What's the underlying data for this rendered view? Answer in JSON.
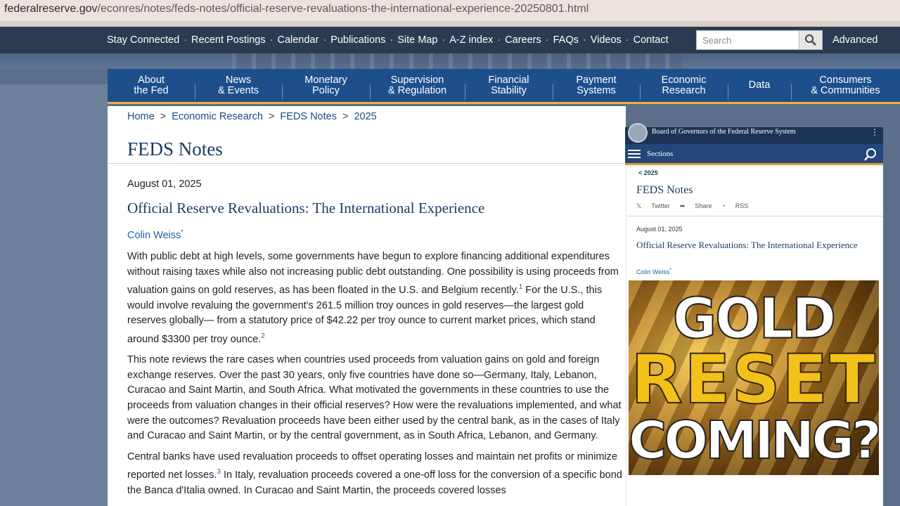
{
  "browser": {
    "url_domain": "federalreserve.gov",
    "url_path": "/econres/notes/feds-notes/official-reserve-revaluations-the-international-experience-20250801.html"
  },
  "topbar": {
    "links": [
      "Stay Connected",
      "Recent Postings",
      "Calendar",
      "Publications",
      "Site Map",
      "A-Z index",
      "Careers",
      "FAQs",
      "Videos",
      "Contact"
    ],
    "search_placeholder": "Search",
    "advanced_label": "Advanced"
  },
  "mainnav": {
    "items": [
      {
        "l1": "About",
        "l2": "the Fed"
      },
      {
        "l1": "News",
        "l2": "& Events"
      },
      {
        "l1": "Monetary",
        "l2": "Policy"
      },
      {
        "l1": "Supervision",
        "l2": "& Regulation"
      },
      {
        "l1": "Financial",
        "l2": "Stability"
      },
      {
        "l1": "Payment",
        "l2": "Systems"
      },
      {
        "l1": "Economic",
        "l2": "Research"
      },
      {
        "l1": "Data",
        "l2": ""
      },
      {
        "l1": "Consumers",
        "l2": "& Communities"
      }
    ]
  },
  "breadcrumb": [
    "Home",
    "Economic Research",
    "FEDS Notes",
    "2025"
  ],
  "section_title": "FEDS Notes",
  "article": {
    "date": "August 01, 2025",
    "title": "Official Reserve Revaluations: The International Experience",
    "author": "Colin Weiss",
    "author_mark": "*",
    "p1_a": "With public debt at high levels, some governments have begun to explore financing additional expenditures without raising taxes while also not increasing public debt outstanding. One possibility is using proceeds from valuation gains on gold reserves, as has been floated in the U.S. and Belgium recently.",
    "fn1": "1",
    "p1_b": " For the U.S., this would involve revaluing the government's 261.5 million troy ounces in gold reserves—the largest gold reserves globally— from a statutory price of $42.22 per troy ounce to current market prices, which stand around $3300 per troy ounce.",
    "fn2": "2",
    "p2": "This note reviews the rare cases when countries used proceeds from valuation gains on gold and foreign exchange reserves. Over the past 30 years, only five countries have done so—Germany, Italy, Lebanon, Curacao and Saint Martin, and South Africa. What motivated the governments in these countries to use the proceeds from valuation changes in their official reserves? How were the revaluations implemented, and what were the outcomes? Revaluation proceeds have been either used by the central bank, as in the cases of Italy and Curacao and Saint Martin, or by the central government, as in South Africa, Lebanon, and Germany.",
    "p3_a": "Central banks have used revaluation proceeds to offset operating losses and maintain net profits or minimize reported net losses.",
    "fn3": "3",
    "p3_b": " In Italy, revaluation proceeds covered a one-off loss for the conversion of a specific bond the Banca d'Italia owned. In Curacao and Saint Martin, the proceeds covered losses"
  },
  "overlay": {
    "header_name": "Board of Governors of the Federal Reserve System",
    "menu_dots": "⋮",
    "sections_label": "Sections",
    "back_label": "< 2025",
    "title": "FEDS Notes",
    "social": [
      "Twitter",
      "Share",
      "RSS"
    ],
    "date": "August 01, 2025",
    "article_title": "Official Reserve Revaluations: The International Experience",
    "author": "Colin Weiss",
    "author_mark": "*",
    "graphic_line1": "GOLD",
    "graphic_line2": "RESET",
    "graphic_line3": "COMING?"
  }
}
